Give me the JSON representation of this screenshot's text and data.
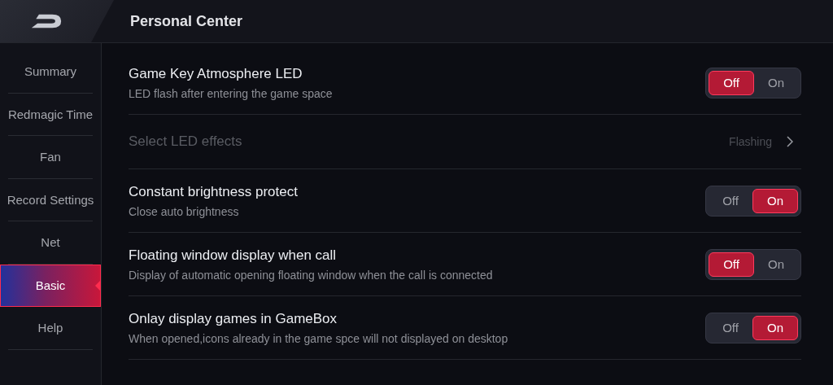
{
  "header": {
    "title": "Personal Center"
  },
  "sidebar": {
    "items": [
      {
        "label": "Summary",
        "selected": false
      },
      {
        "label": "Redmagic Time",
        "selected": false
      },
      {
        "label": "Fan",
        "selected": false
      },
      {
        "label": "Record Settings",
        "selected": false
      },
      {
        "label": "Net",
        "selected": false
      },
      {
        "label": "Basic",
        "selected": true
      },
      {
        "label": "Help",
        "selected": false
      }
    ]
  },
  "settings": [
    {
      "kind": "toggle",
      "title": "Game Key Atmosphere LED",
      "subtitle": "LED flash after entering the game space",
      "options": [
        {
          "label": "Off",
          "selected": true
        },
        {
          "label": "On",
          "selected": false
        }
      ]
    },
    {
      "kind": "link",
      "title": "Select LED effects",
      "value": "Flashing",
      "disabled": true
    },
    {
      "kind": "toggle",
      "title": "Constant brightness protect",
      "subtitle": "Close auto brightness",
      "options": [
        {
          "label": "Off",
          "selected": false
        },
        {
          "label": "On",
          "selected": true
        }
      ]
    },
    {
      "kind": "toggle",
      "title": "Floating window display when call",
      "subtitle": "Display of automatic opening floating window when the call is connected",
      "options": [
        {
          "label": "Off",
          "selected": true
        },
        {
          "label": "On",
          "selected": false
        }
      ]
    },
    {
      "kind": "toggle",
      "title": "Onlay display games in GameBox",
      "subtitle": "When opened,icons already in the game spce will not displayed on desktop",
      "options": [
        {
          "label": "Off",
          "selected": false
        },
        {
          "label": "On",
          "selected": true
        }
      ]
    }
  ]
}
